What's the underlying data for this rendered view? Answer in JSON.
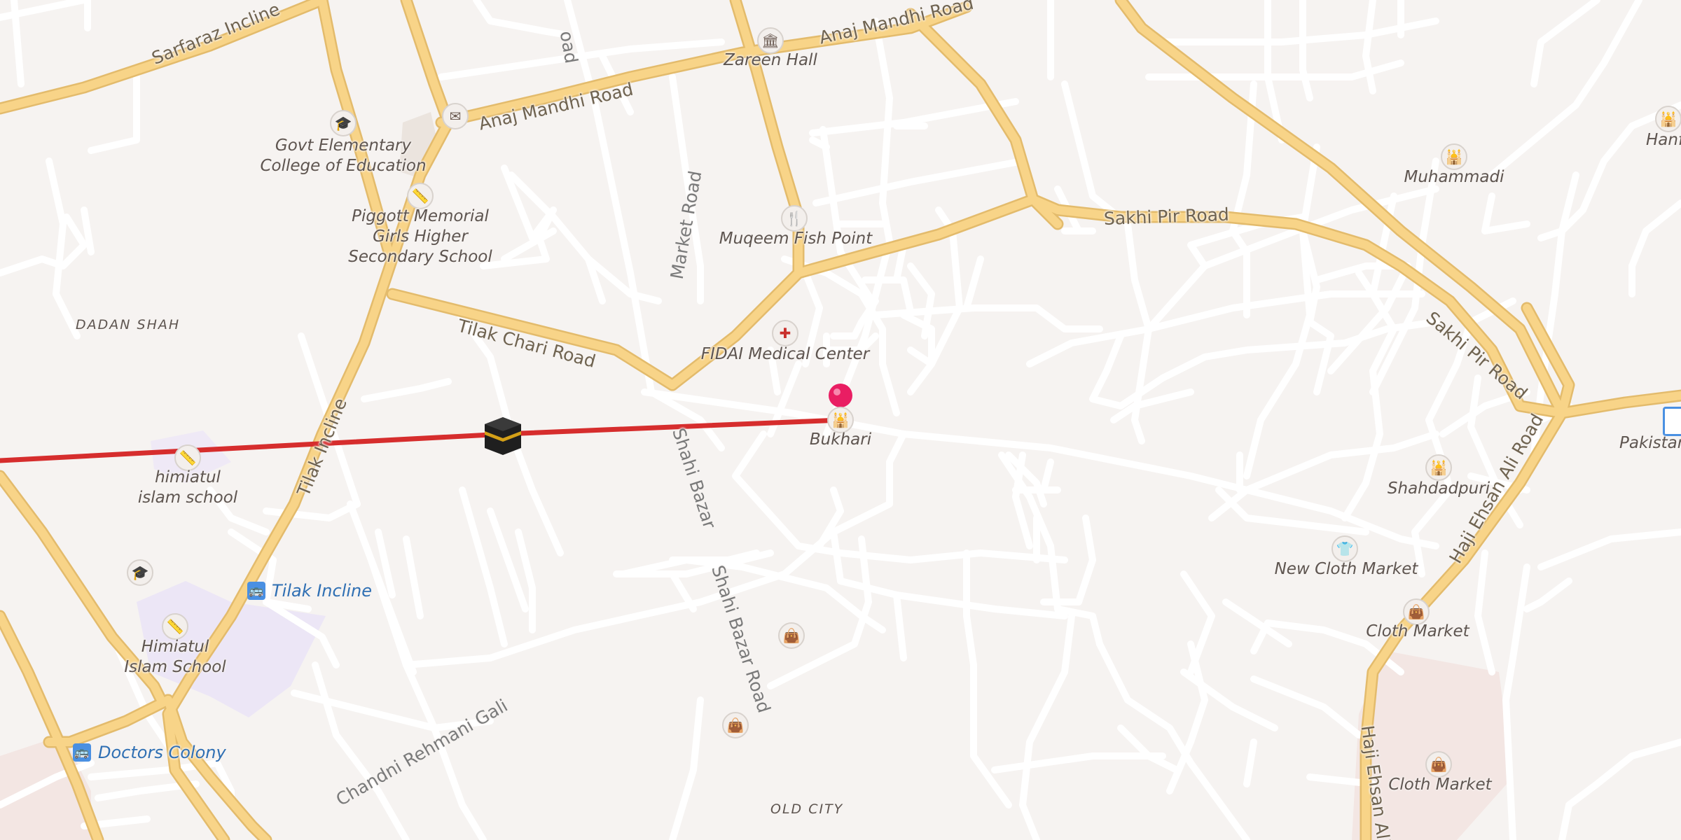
{
  "map": {
    "roads": {
      "sarfaraz_incline": "Sarfaraz Incline",
      "anaj_mandhi_road_top": "Anaj Mandhi Road",
      "anaj_mandhi_road": "Anaj Mandhi Road",
      "market_road": "Market Road",
      "top_road_fragment": "oad",
      "sakhi_pir_road_h": "Sakhi Pir Road",
      "sakhi_pir_road_diag": "Sakhi Pir Road",
      "tilak_chari_road": "Tilak Chari Road",
      "tilak_incline_road": "Tilak Incline",
      "shahi_bazar": "Shahi Bazar",
      "shahi_bazar_road": "Shahi Bazar Road",
      "chandni_rehmani_gali": "Chandni Rehmani Gali",
      "haji_ehsan_ali_road_diag": "Haji Ehsan Ali Road",
      "haji_ehsan_ali_road_bottom": "Haji Ehsan Ali R"
    },
    "areas": {
      "dadan_shah": "DADAN SHAH",
      "old_city": "OLD CITY"
    },
    "pois": {
      "zareen_hall": "Zareen Hall",
      "govt_elementary": "Govt Elementary\nCollege of Education",
      "piggott_school": "Piggott Memorial\nGirls Higher\nSecondary School",
      "muqeem_fish_point": "Muqeem Fish Point",
      "fidai_medical": "FIDAI Medical Center",
      "bukhari": "Bukhari",
      "himiatul_small": "himiatul\nislam school",
      "himiatul_large": "Himiatul\nIslam School",
      "muhammadi": "Muhammadi",
      "hanfi": "Hanfi",
      "shahdadpuri": "Shahdadpuri",
      "new_cloth_market": "New Cloth Market",
      "cloth_market_1": "Cloth Market",
      "cloth_market_2": "Cloth Market",
      "pakistan": "Pakistan"
    },
    "transit": {
      "tilak_incline_stop": "Tilak Incline",
      "doctors_colony_stop": "Doctors Colony"
    },
    "icons": {
      "museum": "museum-icon",
      "post": "post-office-icon",
      "school": "school-icon",
      "restaurant": "restaurant-icon",
      "medical": "medical-cross-icon",
      "mosque": "mosque-icon",
      "shop": "shopping-bag-icon",
      "clothing": "clothing-shop-icon",
      "bus": "bus-stop-icon",
      "kaaba": "kaaba-icon",
      "pin": "location-pin-icon"
    },
    "colors": {
      "background": "#f6f3f1",
      "major_road": "#f8d488",
      "major_road_casing": "#e3bb6c",
      "minor_road": "#ffffff",
      "route_line": "#d62d2d",
      "pin": "#e91e63",
      "school_area": "#ece6f6",
      "pink_area": "#f3e6e3",
      "bus": "#4a90e2"
    }
  }
}
